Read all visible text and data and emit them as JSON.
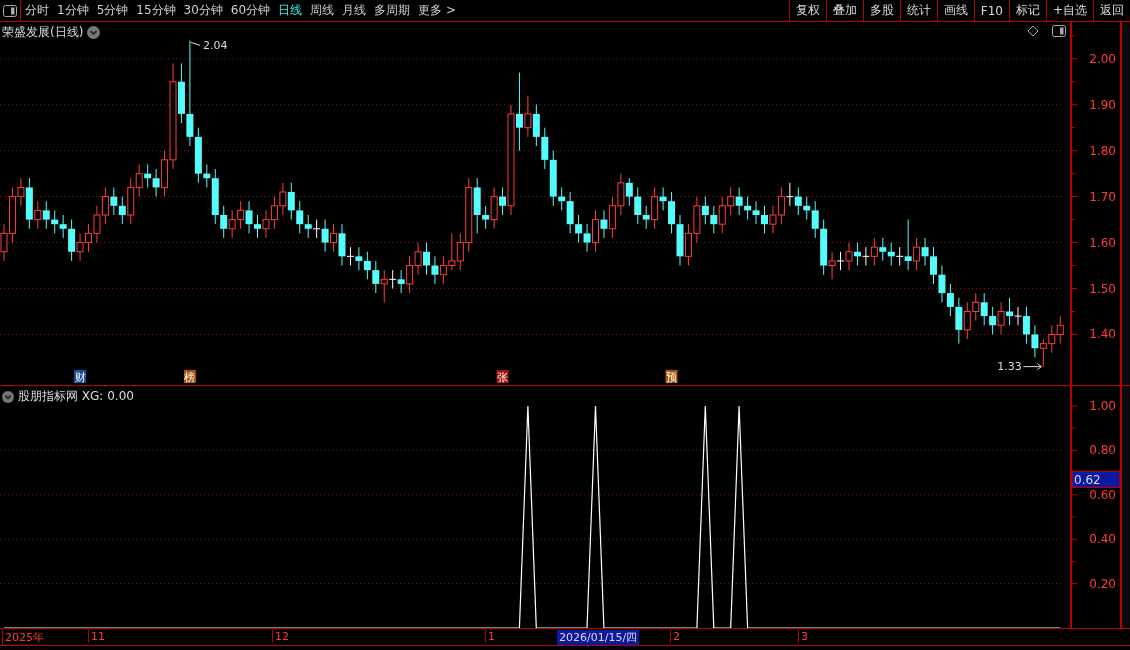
{
  "toolbar": {
    "tabs": [
      {
        "label": "分时",
        "selected": false
      },
      {
        "label": "1分钟",
        "selected": false
      },
      {
        "label": "5分钟",
        "selected": false
      },
      {
        "label": "15分钟",
        "selected": false
      },
      {
        "label": "30分钟",
        "selected": false
      },
      {
        "label": "60分钟",
        "selected": false
      },
      {
        "label": "日线",
        "selected": true
      },
      {
        "label": "周线",
        "selected": false
      },
      {
        "label": "月线",
        "selected": false
      },
      {
        "label": "多周期",
        "selected": false
      },
      {
        "label": "更多 >",
        "selected": false
      }
    ],
    "buttons": [
      "复权",
      "叠加",
      "多股",
      "统计",
      "画线",
      "F10",
      "标记",
      "+自选",
      "返回"
    ]
  },
  "price_pane": {
    "title": "荣盛发展(日线)",
    "chart_data": {
      "type": "candlestick",
      "grid": true,
      "ylim": [
        1.29,
        2.08
      ],
      "yticks": [
        {
          "value": 1.4,
          "label": "1.40"
        },
        {
          "value": 1.5,
          "label": "1.50"
        },
        {
          "value": 1.6,
          "label": "1.60"
        },
        {
          "value": 1.7,
          "label": "1.70"
        },
        {
          "value": 1.8,
          "label": "1.80"
        },
        {
          "value": 1.9,
          "label": "1.90"
        },
        {
          "value": 2.0,
          "label": "2.00"
        }
      ],
      "ohlc": [
        [
          1.58,
          1.64,
          1.56,
          1.62
        ],
        [
          1.62,
          1.72,
          1.6,
          1.7
        ],
        [
          1.7,
          1.74,
          1.68,
          1.72
        ],
        [
          1.72,
          1.74,
          1.63,
          1.65
        ],
        [
          1.65,
          1.69,
          1.63,
          1.67
        ],
        [
          1.67,
          1.69,
          1.63,
          1.65
        ],
        [
          1.65,
          1.67,
          1.62,
          1.64
        ],
        [
          1.64,
          1.66,
          1.61,
          1.63
        ],
        [
          1.63,
          1.65,
          1.56,
          1.58
        ],
        [
          1.58,
          1.62,
          1.56,
          1.6
        ],
        [
          1.6,
          1.64,
          1.58,
          1.62
        ],
        [
          1.62,
          1.68,
          1.6,
          1.66
        ],
        [
          1.66,
          1.72,
          1.64,
          1.7
        ],
        [
          1.7,
          1.72,
          1.66,
          1.68
        ],
        [
          1.68,
          1.7,
          1.64,
          1.66
        ],
        [
          1.66,
          1.74,
          1.64,
          1.72
        ],
        [
          1.72,
          1.77,
          1.7,
          1.75
        ],
        [
          1.75,
          1.77,
          1.72,
          1.74
        ],
        [
          1.74,
          1.76,
          1.7,
          1.72
        ],
        [
          1.72,
          1.8,
          1.7,
          1.78
        ],
        [
          1.78,
          1.99,
          1.76,
          1.95
        ],
        [
          1.95,
          1.99,
          1.86,
          1.88
        ],
        [
          1.88,
          2.04,
          1.81,
          1.83
        ],
        [
          1.83,
          1.85,
          1.73,
          1.75
        ],
        [
          1.75,
          1.77,
          1.72,
          1.74
        ],
        [
          1.74,
          1.76,
          1.64,
          1.66
        ],
        [
          1.66,
          1.68,
          1.61,
          1.63
        ],
        [
          1.63,
          1.67,
          1.61,
          1.65
        ],
        [
          1.65,
          1.69,
          1.63,
          1.67
        ],
        [
          1.67,
          1.69,
          1.62,
          1.64
        ],
        [
          1.64,
          1.66,
          1.61,
          1.63
        ],
        [
          1.63,
          1.67,
          1.61,
          1.65
        ],
        [
          1.65,
          1.7,
          1.63,
          1.68
        ],
        [
          1.68,
          1.73,
          1.66,
          1.71
        ],
        [
          1.71,
          1.73,
          1.65,
          1.67
        ],
        [
          1.67,
          1.69,
          1.62,
          1.64
        ],
        [
          1.64,
          1.66,
          1.61,
          1.63
        ],
        [
          1.63,
          1.65,
          1.61,
          1.63
        ],
        [
          1.63,
          1.65,
          1.58,
          1.6
        ],
        [
          1.6,
          1.64,
          1.58,
          1.62
        ],
        [
          1.62,
          1.64,
          1.55,
          1.57
        ],
        [
          1.57,
          1.59,
          1.55,
          1.57
        ],
        [
          1.57,
          1.59,
          1.54,
          1.56
        ],
        [
          1.56,
          1.58,
          1.52,
          1.54
        ],
        [
          1.54,
          1.56,
          1.49,
          1.51
        ],
        [
          1.51,
          1.54,
          1.47,
          1.52
        ],
        [
          1.52,
          1.54,
          1.5,
          1.52
        ],
        [
          1.52,
          1.54,
          1.49,
          1.51
        ],
        [
          1.51,
          1.57,
          1.49,
          1.55
        ],
        [
          1.55,
          1.6,
          1.53,
          1.58
        ],
        [
          1.58,
          1.6,
          1.53,
          1.55
        ],
        [
          1.55,
          1.57,
          1.51,
          1.53
        ],
        [
          1.53,
          1.57,
          1.51,
          1.55
        ],
        [
          1.55,
          1.62,
          1.54,
          1.56
        ],
        [
          1.56,
          1.62,
          1.54,
          1.6
        ],
        [
          1.6,
          1.74,
          1.58,
          1.72
        ],
        [
          1.72,
          1.74,
          1.62,
          1.66
        ],
        [
          1.66,
          1.68,
          1.63,
          1.65
        ],
        [
          1.65,
          1.72,
          1.63,
          1.7
        ],
        [
          1.7,
          1.72,
          1.66,
          1.68
        ],
        [
          1.68,
          1.9,
          1.66,
          1.88
        ],
        [
          1.88,
          1.97,
          1.8,
          1.85
        ],
        [
          1.85,
          1.92,
          1.83,
          1.88
        ],
        [
          1.88,
          1.9,
          1.81,
          1.83
        ],
        [
          1.83,
          1.85,
          1.76,
          1.78
        ],
        [
          1.78,
          1.8,
          1.68,
          1.7
        ],
        [
          1.7,
          1.72,
          1.67,
          1.69
        ],
        [
          1.69,
          1.71,
          1.62,
          1.64
        ],
        [
          1.64,
          1.66,
          1.6,
          1.62
        ],
        [
          1.62,
          1.64,
          1.58,
          1.6
        ],
        [
          1.6,
          1.67,
          1.58,
          1.65
        ],
        [
          1.65,
          1.67,
          1.61,
          1.63
        ],
        [
          1.63,
          1.7,
          1.61,
          1.68
        ],
        [
          1.68,
          1.75,
          1.66,
          1.73
        ],
        [
          1.73,
          1.74,
          1.68,
          1.7
        ],
        [
          1.7,
          1.72,
          1.64,
          1.66
        ],
        [
          1.66,
          1.68,
          1.63,
          1.65
        ],
        [
          1.65,
          1.72,
          1.63,
          1.7
        ],
        [
          1.7,
          1.72,
          1.67,
          1.69
        ],
        [
          1.69,
          1.71,
          1.62,
          1.64
        ],
        [
          1.64,
          1.66,
          1.55,
          1.57
        ],
        [
          1.57,
          1.64,
          1.55,
          1.62
        ],
        [
          1.62,
          1.7,
          1.6,
          1.68
        ],
        [
          1.68,
          1.7,
          1.64,
          1.66
        ],
        [
          1.66,
          1.68,
          1.62,
          1.64
        ],
        [
          1.64,
          1.7,
          1.62,
          1.68
        ],
        [
          1.68,
          1.72,
          1.66,
          1.7
        ],
        [
          1.7,
          1.72,
          1.66,
          1.68
        ],
        [
          1.68,
          1.7,
          1.65,
          1.67
        ],
        [
          1.67,
          1.69,
          1.64,
          1.66
        ],
        [
          1.66,
          1.68,
          1.62,
          1.64
        ],
        [
          1.64,
          1.68,
          1.62,
          1.66
        ],
        [
          1.66,
          1.72,
          1.64,
          1.7
        ],
        [
          1.7,
          1.73,
          1.68,
          1.7
        ],
        [
          1.7,
          1.72,
          1.66,
          1.68
        ],
        [
          1.68,
          1.7,
          1.65,
          1.67
        ],
        [
          1.67,
          1.69,
          1.61,
          1.63
        ],
        [
          1.63,
          1.65,
          1.53,
          1.55
        ],
        [
          1.55,
          1.58,
          1.52,
          1.56
        ],
        [
          1.56,
          1.58,
          1.54,
          1.56
        ],
        [
          1.56,
          1.6,
          1.54,
          1.58
        ],
        [
          1.58,
          1.6,
          1.55,
          1.57
        ],
        [
          1.57,
          1.59,
          1.55,
          1.57
        ],
        [
          1.57,
          1.61,
          1.55,
          1.59
        ],
        [
          1.59,
          1.61,
          1.56,
          1.58
        ],
        [
          1.58,
          1.6,
          1.55,
          1.57
        ],
        [
          1.57,
          1.59,
          1.55,
          1.57
        ],
        [
          1.57,
          1.65,
          1.54,
          1.56
        ],
        [
          1.56,
          1.61,
          1.54,
          1.59
        ],
        [
          1.59,
          1.61,
          1.55,
          1.57
        ],
        [
          1.57,
          1.59,
          1.51,
          1.53
        ],
        [
          1.53,
          1.55,
          1.47,
          1.49
        ],
        [
          1.49,
          1.51,
          1.44,
          1.46
        ],
        [
          1.46,
          1.48,
          1.38,
          1.41
        ],
        [
          1.41,
          1.47,
          1.39,
          1.45
        ],
        [
          1.45,
          1.49,
          1.43,
          1.47
        ],
        [
          1.47,
          1.49,
          1.42,
          1.44
        ],
        [
          1.44,
          1.46,
          1.4,
          1.42
        ],
        [
          1.42,
          1.47,
          1.4,
          1.45
        ],
        [
          1.45,
          1.48,
          1.42,
          1.44
        ],
        [
          1.44,
          1.46,
          1.42,
          1.44
        ],
        [
          1.44,
          1.46,
          1.38,
          1.4
        ],
        [
          1.4,
          1.42,
          1.35,
          1.37
        ],
        [
          1.37,
          1.39,
          1.33,
          1.38
        ],
        [
          1.38,
          1.42,
          1.36,
          1.4
        ],
        [
          1.4,
          1.44,
          1.38,
          1.42
        ]
      ],
      "annotations": [
        "2.04",
        "1.33"
      ]
    },
    "event_markers": [
      {
        "text": "财",
        "color": "#1d4f96"
      },
      {
        "text": "榜",
        "color": "#a8560c"
      },
      {
        "text": "张",
        "color": "#a01010"
      },
      {
        "text": "预",
        "color": "#a8560c"
      }
    ]
  },
  "indicator_pane": {
    "title": "股朋指标网 XG: 0.00",
    "cursor_value": "0.62",
    "chart_data": {
      "type": "line",
      "grid": true,
      "ylim": [
        0,
        1.09
      ],
      "yticks": [
        {
          "value": 0.2,
          "label": "0.20"
        },
        {
          "value": 0.4,
          "label": "0.40"
        },
        {
          "value": 0.6,
          "label": "0.60"
        },
        {
          "value": 0.8,
          "label": "0.80"
        },
        {
          "value": 1.0,
          "label": "1.00"
        }
      ],
      "values": [
        0,
        0,
        0,
        0,
        0,
        0,
        0,
        0,
        0,
        0,
        0,
        0,
        0,
        0,
        0,
        0,
        0,
        0,
        0,
        0,
        0,
        0,
        0,
        0,
        0,
        0,
        0,
        0,
        0,
        0,
        0,
        0,
        0,
        0,
        0,
        0,
        0,
        0,
        0,
        0,
        0,
        0,
        0,
        0,
        0,
        0,
        0,
        0,
        0,
        0,
        0,
        0,
        0,
        0,
        0,
        0,
        0,
        0,
        0,
        0,
        0,
        0,
        1,
        0,
        0,
        0,
        0,
        0,
        0,
        0,
        1,
        0,
        0,
        0,
        0,
        0,
        0,
        0,
        0,
        0,
        0,
        0,
        0,
        1,
        0,
        0,
        0,
        1,
        0,
        0,
        0,
        0,
        0,
        0,
        0,
        0,
        0,
        0,
        0,
        0,
        0,
        0,
        0,
        0,
        0,
        0,
        0,
        0,
        0,
        0,
        0,
        0,
        0,
        0,
        0,
        0,
        0,
        0,
        0,
        0,
        0,
        0,
        0,
        0,
        0,
        0
      ]
    }
  },
  "time_axis": {
    "labels": [
      "2025年",
      "11",
      "12",
      "1",
      "2",
      "3"
    ],
    "cursor_date": "2026/01/15/四"
  }
}
